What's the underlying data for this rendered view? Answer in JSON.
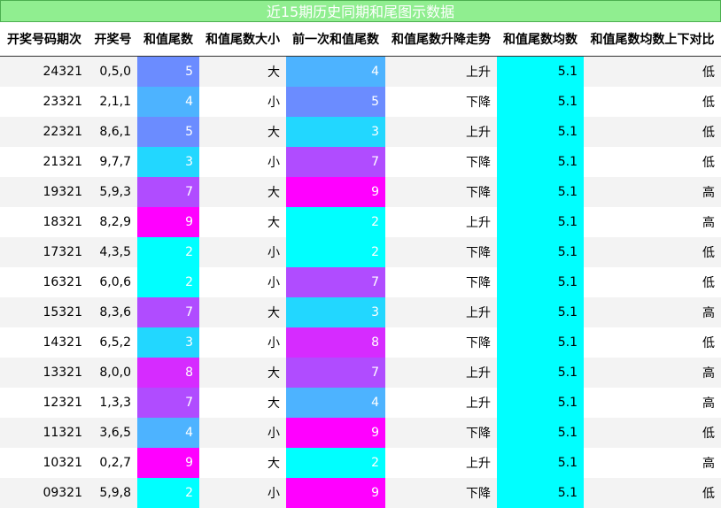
{
  "title": "近15期历史同期和尾图示数据",
  "headers": [
    "开奖号码期次",
    "开奖号",
    "和值尾数",
    "和值尾数大小",
    "前一次和值尾数",
    "和值尾数升降走势",
    "和值尾数均数",
    "和值尾数均数上下对比"
  ],
  "digit_colors": {
    "2": "#00ffff",
    "3": "#22d7ff",
    "4": "#4db3ff",
    "5": "#6b8cff",
    "7": "#b04cff",
    "8": "#d62bff",
    "9": "#ff00ff"
  },
  "average_color": "#00ffff",
  "rows": [
    {
      "issue": "24321",
      "numbers": "0,5,0",
      "tail": "5",
      "size": "大",
      "prev_tail": "4",
      "trend": "上升",
      "avg": "5.1",
      "compare": "低"
    },
    {
      "issue": "23321",
      "numbers": "2,1,1",
      "tail": "4",
      "size": "小",
      "prev_tail": "5",
      "trend": "下降",
      "avg": "5.1",
      "compare": "低"
    },
    {
      "issue": "22321",
      "numbers": "8,6,1",
      "tail": "5",
      "size": "大",
      "prev_tail": "3",
      "trend": "上升",
      "avg": "5.1",
      "compare": "低"
    },
    {
      "issue": "21321",
      "numbers": "9,7,7",
      "tail": "3",
      "size": "小",
      "prev_tail": "7",
      "trend": "下降",
      "avg": "5.1",
      "compare": "低"
    },
    {
      "issue": "19321",
      "numbers": "5,9,3",
      "tail": "7",
      "size": "大",
      "prev_tail": "9",
      "trend": "下降",
      "avg": "5.1",
      "compare": "高"
    },
    {
      "issue": "18321",
      "numbers": "8,2,9",
      "tail": "9",
      "size": "大",
      "prev_tail": "2",
      "trend": "上升",
      "avg": "5.1",
      "compare": "高"
    },
    {
      "issue": "17321",
      "numbers": "4,3,5",
      "tail": "2",
      "size": "小",
      "prev_tail": "2",
      "trend": "下降",
      "avg": "5.1",
      "compare": "低"
    },
    {
      "issue": "16321",
      "numbers": "6,0,6",
      "tail": "2",
      "size": "小",
      "prev_tail": "7",
      "trend": "下降",
      "avg": "5.1",
      "compare": "低"
    },
    {
      "issue": "15321",
      "numbers": "8,3,6",
      "tail": "7",
      "size": "大",
      "prev_tail": "3",
      "trend": "上升",
      "avg": "5.1",
      "compare": "高"
    },
    {
      "issue": "14321",
      "numbers": "6,5,2",
      "tail": "3",
      "size": "小",
      "prev_tail": "8",
      "trend": "下降",
      "avg": "5.1",
      "compare": "低"
    },
    {
      "issue": "13321",
      "numbers": "8,0,0",
      "tail": "8",
      "size": "大",
      "prev_tail": "7",
      "trend": "上升",
      "avg": "5.1",
      "compare": "高"
    },
    {
      "issue": "12321",
      "numbers": "1,3,3",
      "tail": "7",
      "size": "大",
      "prev_tail": "4",
      "trend": "上升",
      "avg": "5.1",
      "compare": "高"
    },
    {
      "issue": "11321",
      "numbers": "3,6,5",
      "tail": "4",
      "size": "小",
      "prev_tail": "9",
      "trend": "下降",
      "avg": "5.1",
      "compare": "低"
    },
    {
      "issue": "10321",
      "numbers": "0,2,7",
      "tail": "9",
      "size": "大",
      "prev_tail": "2",
      "trend": "上升",
      "avg": "5.1",
      "compare": "高"
    },
    {
      "issue": "09321",
      "numbers": "5,9,8",
      "tail": "2",
      "size": "小",
      "prev_tail": "9",
      "trend": "下降",
      "avg": "5.1",
      "compare": "低"
    }
  ]
}
